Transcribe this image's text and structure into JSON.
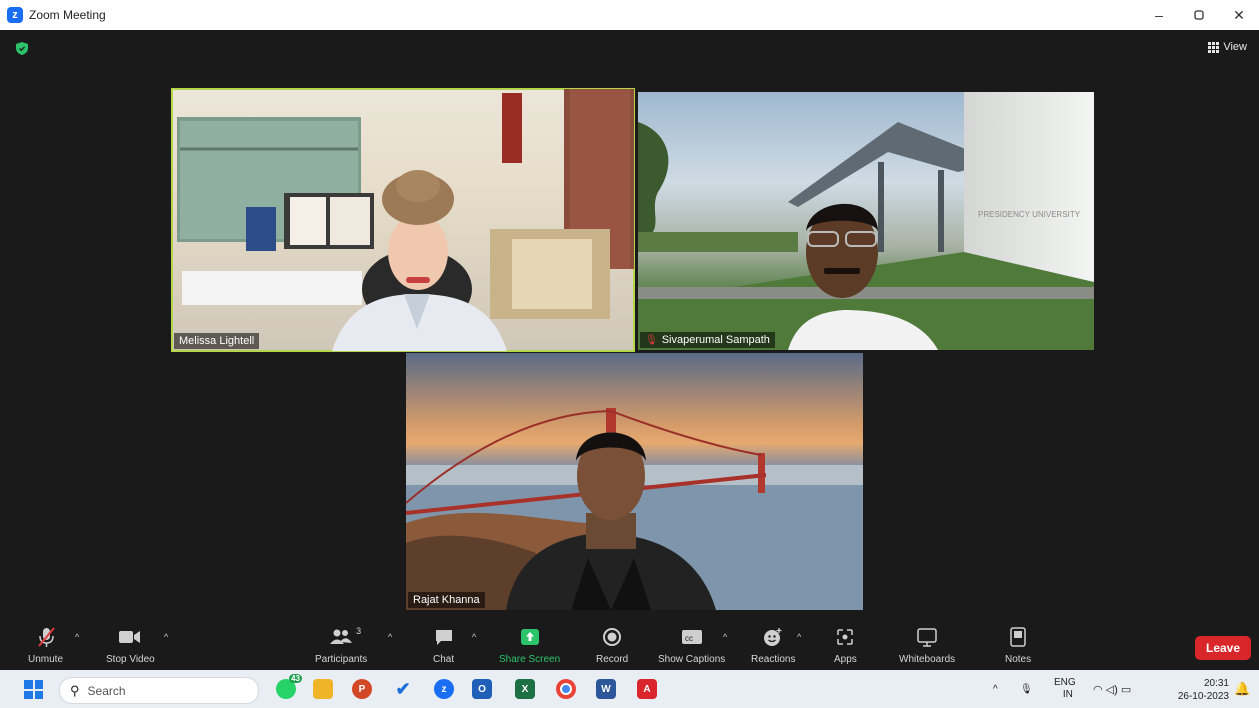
{
  "window": {
    "title": "Zoom Meeting",
    "min": "–",
    "max": "▢",
    "close": "✕"
  },
  "meeting": {
    "view_label": "View",
    "participants": [
      {
        "name": "Melissa Lightell"
      },
      {
        "name": "Sivaperumal Sampath",
        "muted": true
      },
      {
        "name": "Rajat Khanna"
      }
    ],
    "sign_text": "PRESIDENCY UNIVERSITY"
  },
  "toolbar": {
    "unmute": "Unmute",
    "stop_video": "Stop Video",
    "participants": "Participants",
    "participants_count": "3",
    "chat": "Chat",
    "share_screen": "Share Screen",
    "record": "Record",
    "show_captions": "Show Captions",
    "reactions": "Reactions",
    "apps": "Apps",
    "whiteboards": "Whiteboards",
    "notes": "Notes",
    "leave": "Leave"
  },
  "taskbar": {
    "search_placeholder": "Search",
    "whatsapp_badge": "43",
    "lang_top": "ENG",
    "lang_bottom": "IN",
    "time": "20:31",
    "date": "26-10-2023"
  },
  "colors": {
    "accent_green": "#2dc36a",
    "leave_red": "#d9262b",
    "active_border": "#b5d54a",
    "zoom_blue": "#1a6ef3"
  }
}
